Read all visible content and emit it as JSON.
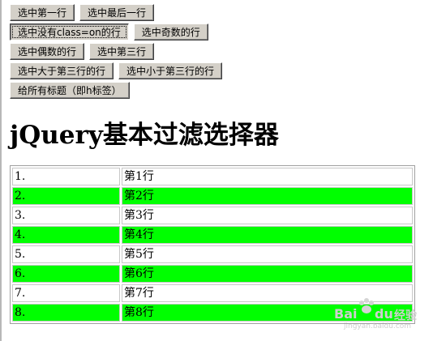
{
  "buttons": {
    "row1": [
      "选中第一行",
      "选中最后一行"
    ],
    "row2": [
      "选中没有class=on的行",
      "选中奇数的行"
    ],
    "row3": [
      "选中偶数的行",
      "选中第三行"
    ],
    "row4": [
      "选中大于第三行的行",
      "选中小于第三行的行"
    ],
    "row5": [
      "给所有标题（即h标签）"
    ]
  },
  "heading": "jQuery基本过滤选择器",
  "table": {
    "highlight_color": "#00ff00",
    "rows": [
      [
        "1.",
        "第1行"
      ],
      [
        "2.",
        "第2行"
      ],
      [
        "3.",
        "第3行"
      ],
      [
        "4.",
        "第4行"
      ],
      [
        "5.",
        "第5行"
      ],
      [
        "6.",
        "第6行"
      ],
      [
        "7.",
        "第7行"
      ],
      [
        "8.",
        "第8行"
      ]
    ]
  },
  "watermark": {
    "brand_a": "Bai",
    "brand_b": "du",
    "brand_c": "经验",
    "url": "jingyan.baidu.com"
  }
}
